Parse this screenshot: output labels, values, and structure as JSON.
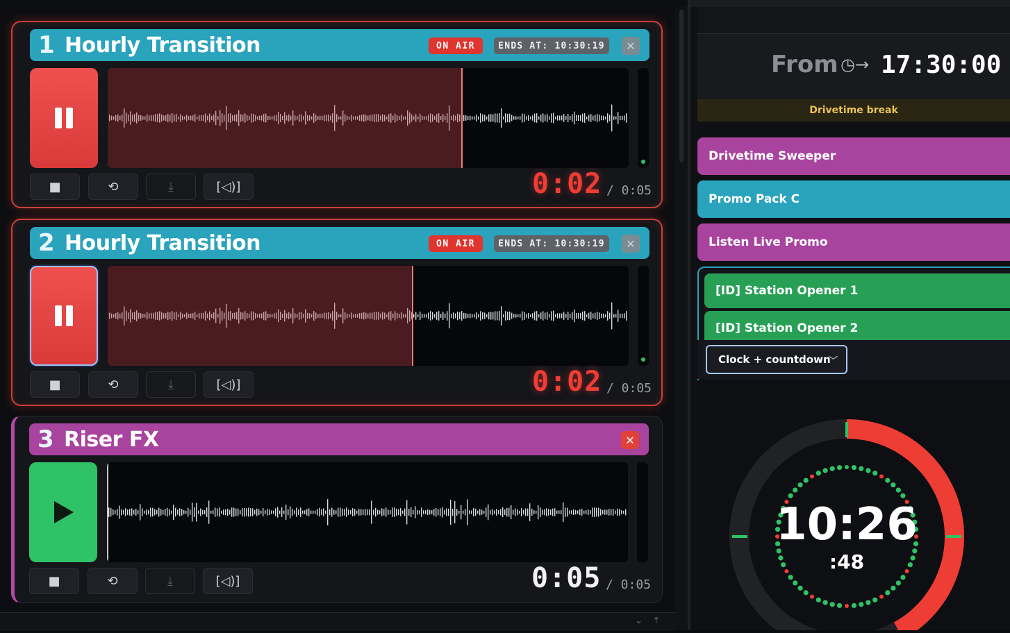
{
  "players": [
    {
      "number": "1",
      "title": "Hourly Transition",
      "state": "on-air",
      "on_air_label": "ON AIR",
      "ends_label": "ENDS AT: 10:30:19",
      "elapsed": "0:02",
      "duration": "/ 0:05",
      "progress": 0.68,
      "header_color": "#2aa3bd"
    },
    {
      "number": "2",
      "title": "Hourly Transition",
      "state": "on-air",
      "on_air_label": "ON AIR",
      "ends_label": "ENDS AT: 10:30:19",
      "elapsed": "0:02",
      "duration": "/ 0:05",
      "progress": 0.585,
      "header_color": "#2aa3bd"
    },
    {
      "number": "3",
      "title": "Riser FX",
      "state": "ready",
      "elapsed": "0:05",
      "duration": "/ 0:05",
      "progress": 0.0,
      "header_color": "#a8449e"
    }
  ],
  "player_controls": [
    "stop-icon",
    "loop-icon",
    "download-icon",
    "volume-bracket-icon"
  ],
  "schedule": {
    "from_label": "From",
    "from_icon": "clock-arrow-icon",
    "from_time": "17:30:00",
    "break_label": "Drivetime break"
  },
  "carts": [
    {
      "label": "Drivetime Sweeper",
      "color": "#a8449e"
    },
    {
      "label": "Promo Pack C",
      "color": "#2aa3bd"
    },
    {
      "label": "Listen Live Promo",
      "color": "#a8449e"
    }
  ],
  "group_carts": [
    {
      "label": "[ID] Station Opener 1",
      "color": "#27a055"
    },
    {
      "label": "[ID] Station Opener 2",
      "color": "#27a055"
    }
  ],
  "clock": {
    "mode_label": "Clock + countdown",
    "time": "10:26",
    "seconds": ":48",
    "countdown_fraction": 0.42,
    "ring_color": "#ee3d35",
    "dot_active_color": "#2fc267",
    "dot_accent_color": "#ee3d35"
  }
}
